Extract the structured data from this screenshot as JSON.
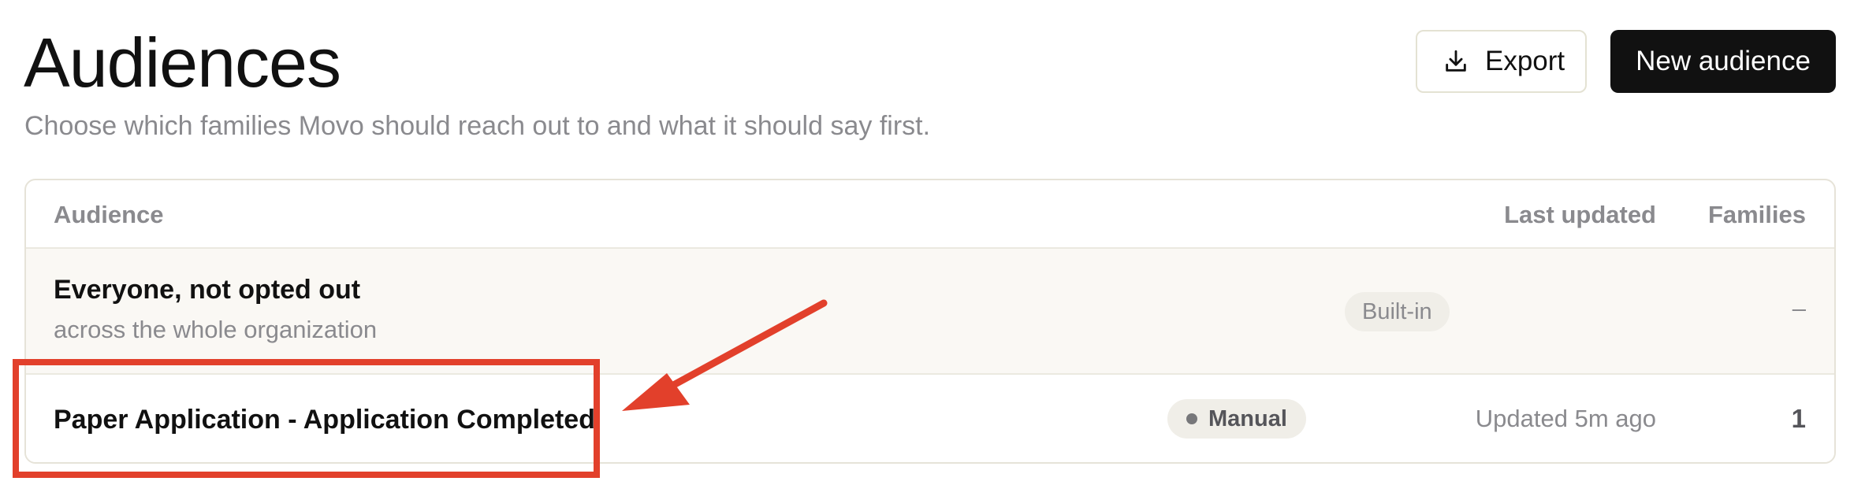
{
  "header": {
    "title": "Audiences",
    "subtitle": "Choose which families Movo should reach out to and what it should say first."
  },
  "actions": {
    "export_label": "Export",
    "export_icon": "download-icon",
    "new_label": "New audience"
  },
  "table": {
    "columns": {
      "audience": "Audience",
      "last_updated": "Last updated",
      "families": "Families"
    },
    "rows": [
      {
        "name": "Everyone, not opted out",
        "description": "across the whole organization",
        "badge": "Built-in",
        "last_updated": "",
        "families": "–"
      },
      {
        "name": "Paper Application - Application Completed",
        "badge": "Manual",
        "last_updated": "Updated 5m ago",
        "families": "1"
      }
    ]
  },
  "colors": {
    "annotation": "#e2402b",
    "primary_button": "#111111",
    "muted_text": "#8a8a8e"
  }
}
